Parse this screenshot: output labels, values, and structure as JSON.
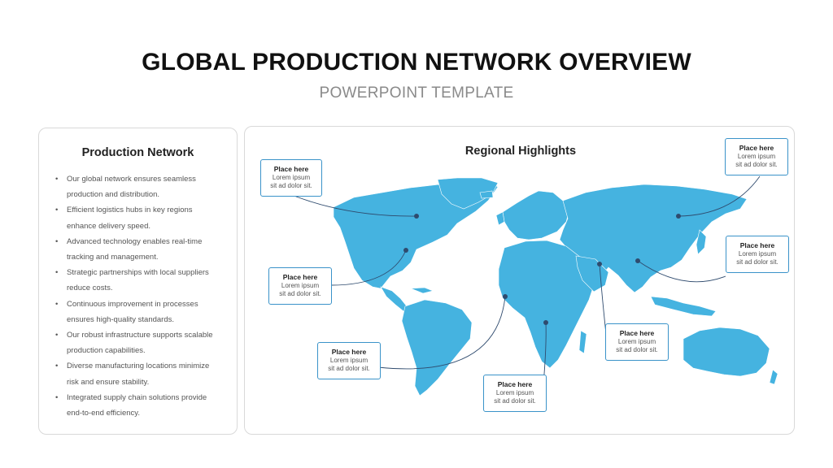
{
  "header": {
    "title": "GLOBAL PRODUCTION NETWORK OVERVIEW",
    "subtitle": "POWERPOINT TEMPLATE"
  },
  "left_panel": {
    "title": "Production Network",
    "bullets": [
      "Our global network ensures seamless production and distribution.",
      "Efficient logistics hubs in key regions enhance delivery speed.",
      "Advanced technology enables real-time tracking and management.",
      "Strategic partnerships with local suppliers reduce costs.",
      "Continuous improvement in processes ensures high-quality standards.",
      "Our robust infrastructure supports scalable production capabilities.",
      "Diverse manufacturing locations minimize risk and ensure stability.",
      "Integrated supply chain solutions provide end-to-end efficiency."
    ]
  },
  "map_panel": {
    "title": "Regional Highlights",
    "map_color": "#45b3e0",
    "callouts": [
      {
        "heading": "Place here",
        "line1": "Lorem ipsum",
        "line2": "sit ad dolor sit."
      },
      {
        "heading": "Place here",
        "line1": "Lorem ipsum",
        "line2": "sit ad dolor sit."
      },
      {
        "heading": "Place here",
        "line1": "Lorem ipsum",
        "line2": "sit ad dolor sit."
      },
      {
        "heading": "Place here",
        "line1": "Lorem ipsum",
        "line2": "sit ad dolor sit."
      },
      {
        "heading": "Place here",
        "line1": "Lorem ipsum",
        "line2": "sit ad dolor sit."
      },
      {
        "heading": "Place here",
        "line1": "Lorem ipsum",
        "line2": "sit ad dolor sit."
      },
      {
        "heading": "Place here",
        "line1": "Lorem ipsum",
        "line2": "sit ad dolor sit."
      }
    ]
  }
}
